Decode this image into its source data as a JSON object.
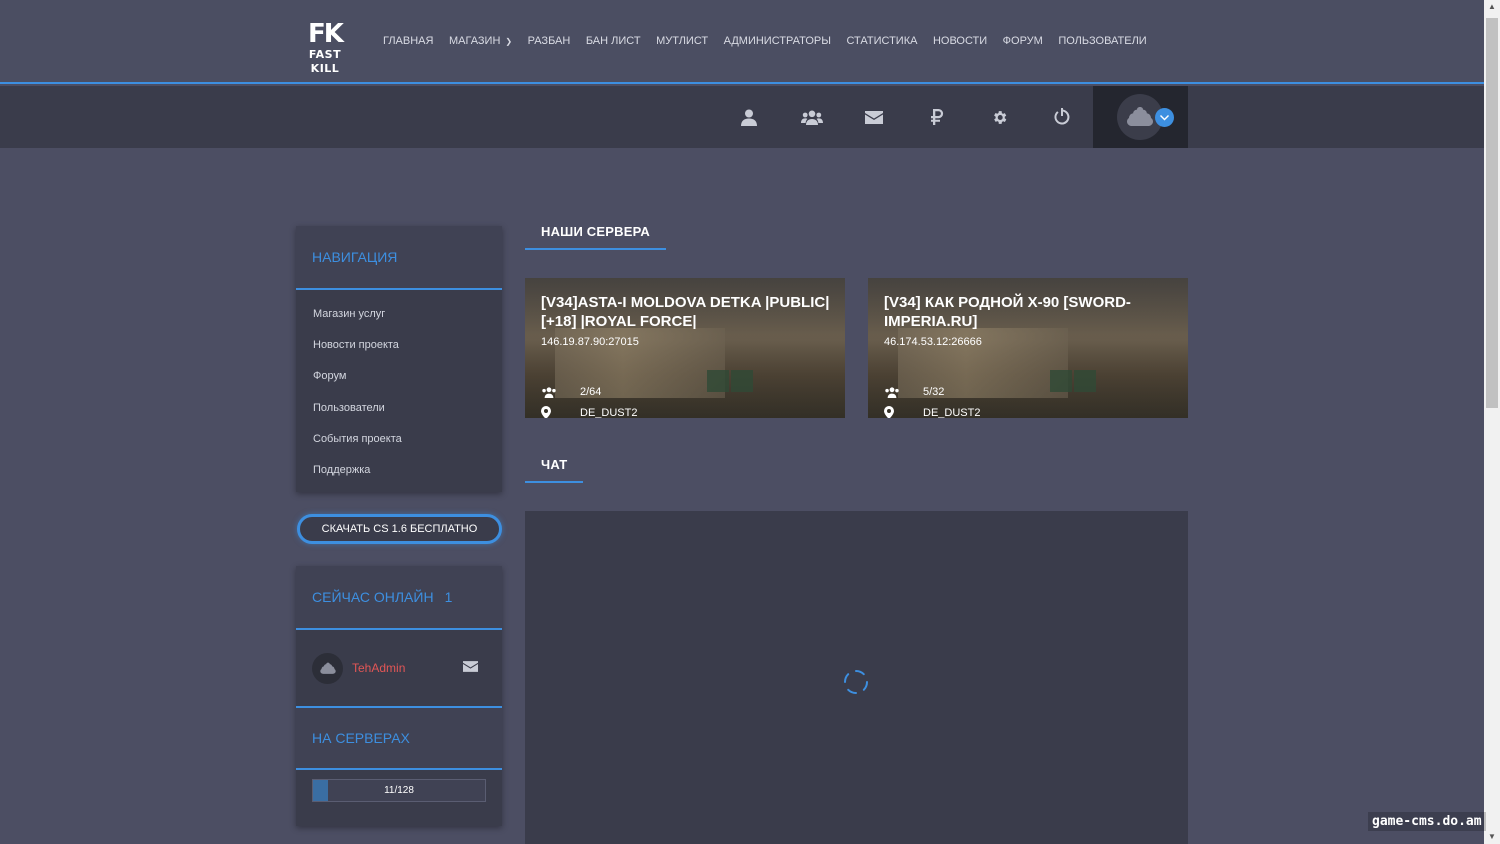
{
  "brand": {
    "mark": "FK",
    "word": "FAST KILL"
  },
  "menu": [
    {
      "label": "ГЛАВНАЯ"
    },
    {
      "label": "МАГАЗИН",
      "dropdown": true
    },
    {
      "label": "РАЗБАН"
    },
    {
      "label": "БАН ЛИСТ"
    },
    {
      "label": "МУТЛИСТ"
    },
    {
      "label": "АДМИНИСТРАТОРЫ"
    },
    {
      "label": "СТАТИСТИКА"
    },
    {
      "label": "НОВОСТИ"
    },
    {
      "label": "ФОРУМ"
    },
    {
      "label": "ПОЛЬЗОВАТЕЛИ"
    }
  ],
  "toolbar_icons": [
    "user-icon",
    "users-icon",
    "envelope-icon",
    "ruble-icon",
    "gear-icon",
    "power-icon"
  ],
  "sidebar": {
    "nav_title": "НАВИГАЦИЯ",
    "nav_items": [
      {
        "label": "Магазин услуг"
      },
      {
        "label": "Новости проекта"
      },
      {
        "label": "Форум"
      },
      {
        "label": "Пользователи"
      },
      {
        "label": "События проекта"
      },
      {
        "label": "Поддержка"
      }
    ],
    "download_label": "СКАЧАТЬ CS 1.6 БЕСПЛАТНО",
    "online_title": "СЕЙЧАС ОНЛАЙН",
    "online_count": "1",
    "online_users": [
      {
        "name": "TehAdmin"
      }
    ],
    "servers_title": "НА СЕРВЕРАХ",
    "servers_players": "11/128",
    "servers_fraction": 0.086
  },
  "main": {
    "servers_title": "НАШИ СЕРВЕРА",
    "servers": [
      {
        "name": "[V34]ASTA-I MOLDOVA DETKA |PUBLIC| [+18] |ROYAL FORCE|",
        "ip": "146.19.87.90:27015",
        "players": "2/64",
        "map": "DE_DUST2"
      },
      {
        "name": "[V34] КАК РОДНОЙ X-90 [SWORD-IMPERIA.RU]",
        "ip": "46.174.53.12:26666",
        "players": "5/32",
        "map": "DE_DUST2"
      }
    ],
    "chat_title": "ЧАТ"
  },
  "watermark": "game-cms.do.am",
  "colors": {
    "accent": "#3d8fe0",
    "background": "#4c4e63",
    "panel": "#3a3c4b",
    "username": "#e25656"
  }
}
